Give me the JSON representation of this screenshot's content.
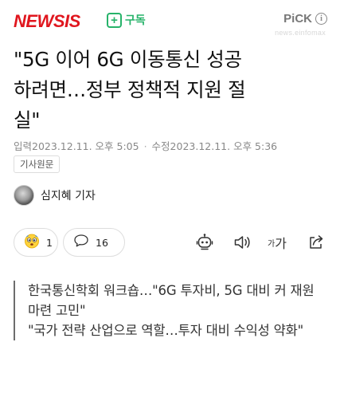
{
  "header": {
    "logo": "NEWSIS",
    "subscribe_plus": "+",
    "subscribe_label": "구독",
    "pick_label": "PiCK",
    "pick_info": "i",
    "watermark": "news.einfomax"
  },
  "article": {
    "title_lines": [
      "\"5G 이어 6G 이동통신 성공",
      "하려면…정부 정책적 지원 절",
      "실\""
    ],
    "input_label": "입력",
    "input_time": "2023.12.11. 오후 5:05",
    "separator": "·",
    "modified_label": "수정",
    "modified_time": "2023.12.11. 오후 5:36",
    "source_chip": "기사원문",
    "reporter": "심지혜 기자"
  },
  "actions": {
    "reaction_count": "1",
    "comment_count": "16",
    "font_small": "가",
    "font_large": "가"
  },
  "summary": [
    "한국통신학회 워크숍…\"6G 투자비, 5G 대비 커 재원 마련 고민\"",
    "\"국가 전략 산업으로 역할…투자 대비 수익성 약화\""
  ],
  "colors": {
    "brand": "#e0161e",
    "subscribe": "#27b36a",
    "meta_text": "#888888"
  },
  "icons": [
    "plus-icon",
    "info-icon",
    "emoji-reaction-icon",
    "comment-icon",
    "ai-bot-icon",
    "speaker-icon",
    "font-size-icon",
    "share-icon"
  ]
}
